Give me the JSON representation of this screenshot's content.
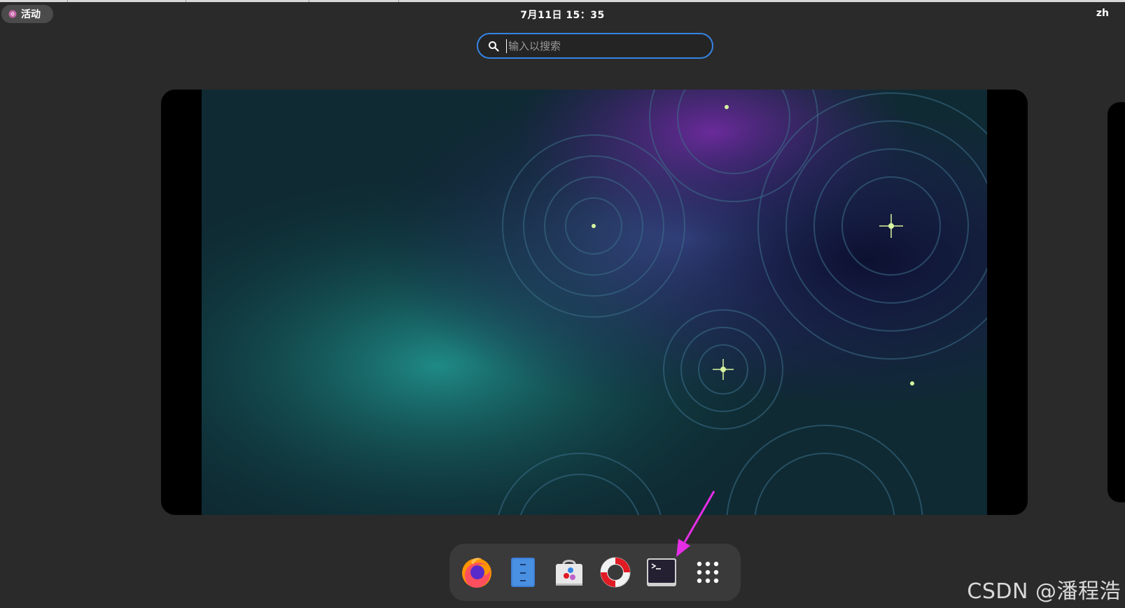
{
  "topbar": {
    "activities_label": "活动",
    "clock": "7月11日  15：35",
    "input_method": "zh"
  },
  "search": {
    "placeholder": "输入以搜索",
    "value": ""
  },
  "dash": {
    "apps": [
      {
        "icon": "firefox-icon"
      },
      {
        "icon": "files-icon"
      },
      {
        "icon": "software-store-icon"
      },
      {
        "icon": "help-lifebuoy-icon"
      },
      {
        "icon": "terminal-icon"
      },
      {
        "icon": "show-apps-grid-icon"
      }
    ]
  },
  "annotation": {
    "color": "#e62ee6",
    "points_to": "terminal-icon"
  },
  "watermark": "CSDN @潘程浩",
  "colors": {
    "accent": "#3584e4",
    "panel": "#2a2a2a",
    "dash": "#3a3a3a"
  }
}
